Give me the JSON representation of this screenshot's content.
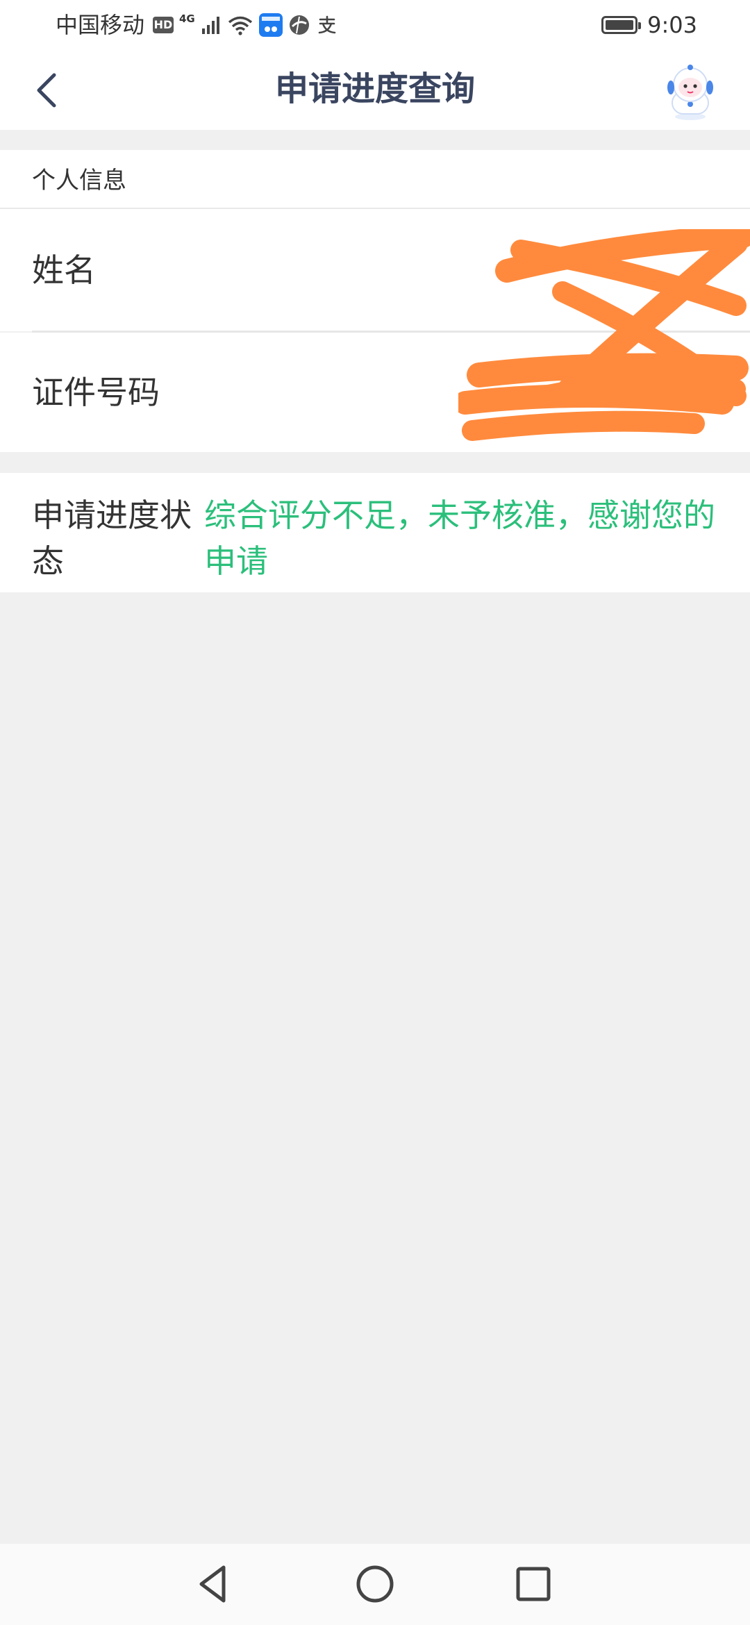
{
  "status_bar": {
    "carrier": "中国移动",
    "hd": "HD",
    "network": "4G",
    "time": "9:03"
  },
  "nav": {
    "title": "申请进度查询",
    "title_color": "#3a4560"
  },
  "personal_info": {
    "header": "个人信息",
    "name_label": "姓名",
    "id_label": "证件号码"
  },
  "status": {
    "label": "申请进度状态",
    "value": "综合评分不足，未予核准，感谢您的申请",
    "value_color": "#2bbf7b"
  },
  "redaction_color": "#ff8a3d",
  "icons": {
    "back": "back-chevron-icon",
    "assistant": "robot-assistant-icon",
    "nav_back": "nav-back-triangle-icon",
    "nav_home": "nav-home-circle-icon",
    "nav_recents": "nav-recents-square-icon"
  }
}
